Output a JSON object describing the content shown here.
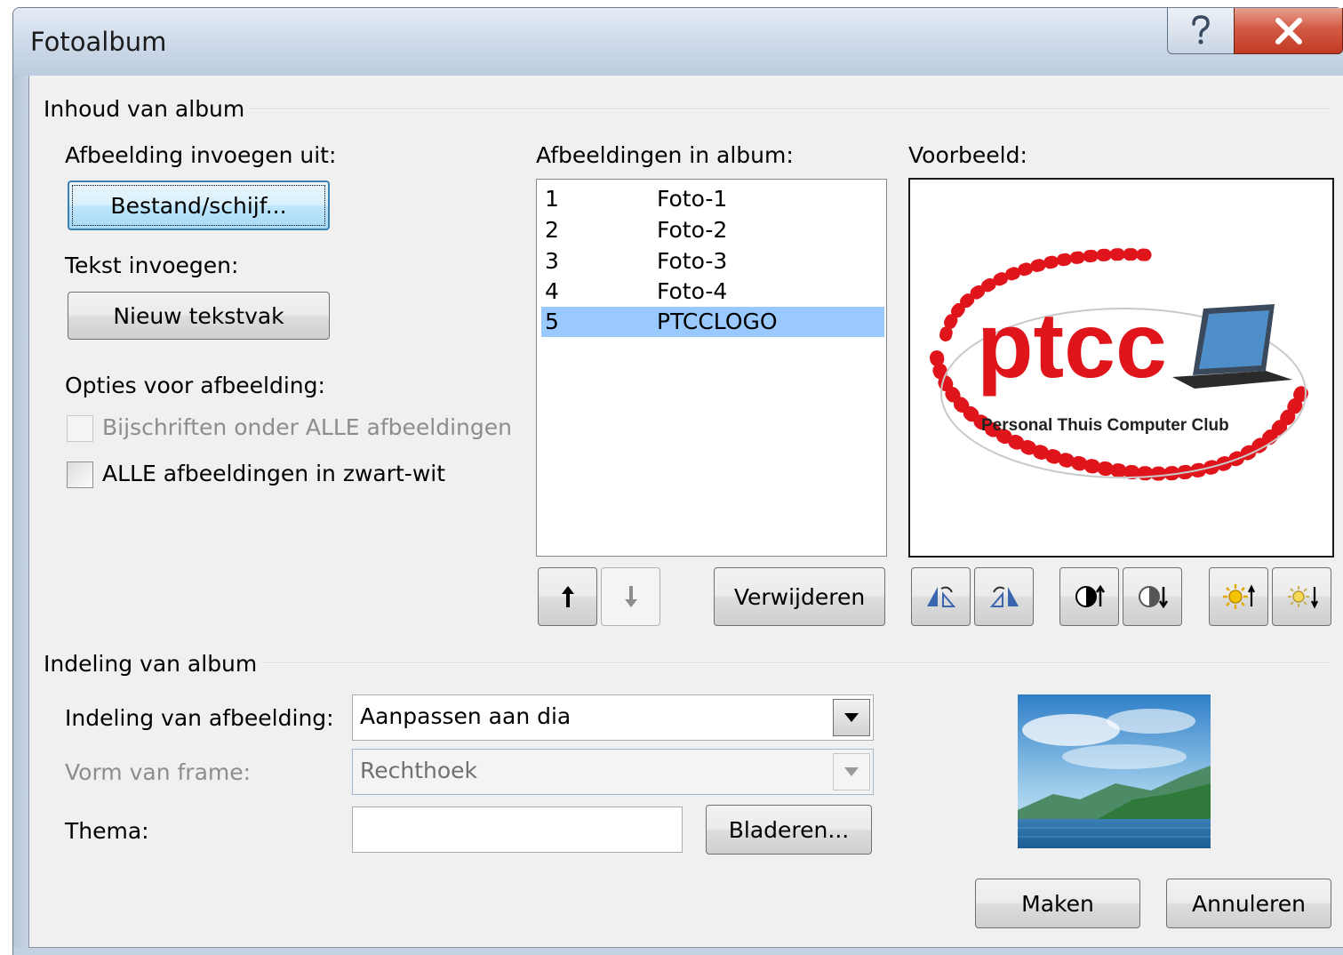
{
  "window": {
    "title": "Fotoalbum",
    "help_icon": "question-mark-icon",
    "close_icon": "close-x-icon"
  },
  "album_content": {
    "group_label": "Inhoud van album",
    "insert_from_label": "Afbeelding invoegen uit:",
    "file_disk_button": "Bestand/schijf...",
    "insert_text_label": "Tekst invoegen:",
    "new_textbox_button": "Nieuw tekstvak",
    "picture_options_label": "Opties voor afbeelding:",
    "captions_checkbox": {
      "label": "Bijschriften onder ALLE afbeeldingen",
      "checked": false,
      "enabled": false
    },
    "bw_checkbox": {
      "label": "ALLE afbeeldingen in zwart-wit",
      "checked": false,
      "enabled": true
    },
    "pictures_in_album_label": "Afbeeldingen in album:",
    "pictures": [
      {
        "num": "1",
        "name": "Foto-1",
        "selected": false
      },
      {
        "num": "2",
        "name": "Foto-2",
        "selected": false
      },
      {
        "num": "3",
        "name": "Foto-3",
        "selected": false
      },
      {
        "num": "4",
        "name": "Foto-4",
        "selected": false
      },
      {
        "num": "5",
        "name": "PTCCLOGO",
        "selected": true
      }
    ],
    "move_up_icon": "arrow-up-icon",
    "move_down_icon": "arrow-down-icon",
    "remove_button": "Verwijderen",
    "preview_label": "Voorbeeld:",
    "preview_logo": {
      "wordmark": "ptcc",
      "tagline": "Personal Thuis Computer Club"
    },
    "image_tools": [
      "rotate-left-icon",
      "rotate-right-icon",
      "contrast-up-icon",
      "contrast-down-icon",
      "brightness-up-icon",
      "brightness-down-icon"
    ]
  },
  "album_layout": {
    "group_label": "Indeling van album",
    "picture_layout_label": "Indeling van afbeelding:",
    "picture_layout_value": "Aanpassen aan dia",
    "frame_shape_label": "Vorm van frame:",
    "frame_shape_value": "Rechthoek",
    "theme_label": "Thema:",
    "theme_value": "",
    "browse_button": "Bladeren...",
    "layout_preview": "landscape-thumbnail"
  },
  "footer": {
    "create_button": "Maken",
    "cancel_button": "Annuleren"
  },
  "colors": {
    "selection": "#99c9ff",
    "dialog_bg": "#f0f0f0",
    "logo_red": "#e0141b"
  }
}
